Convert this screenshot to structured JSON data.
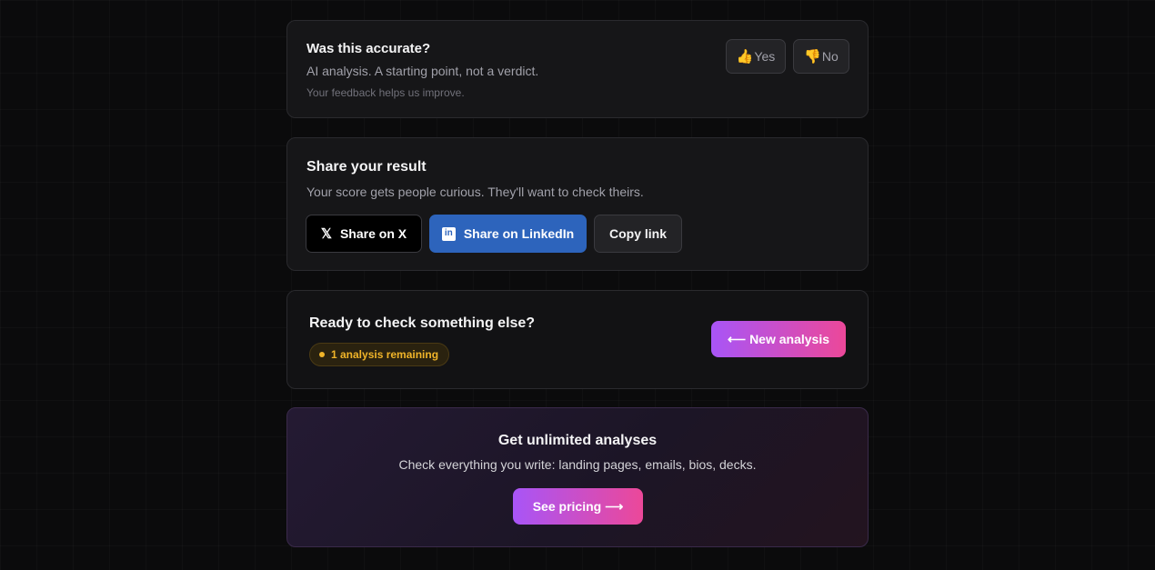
{
  "feedback": {
    "title": "Was this accurate?",
    "subtitle": "AI analysis. A starting point, not a verdict.",
    "note": "Your feedback helps us improve.",
    "yes_icon": "👍",
    "yes_label": "Yes",
    "no_icon": "👎",
    "no_label": "No"
  },
  "share": {
    "title": "Share your result",
    "subtitle": "Your score gets people curious. They'll want to check theirs.",
    "x_icon": "𝕏",
    "x_label": "Share on X",
    "linkedin_icon": "in",
    "linkedin_label": "Share on LinkedIn",
    "copy_label": "Copy link"
  },
  "next": {
    "title": "Ready to check something else?",
    "remaining_label": "1 analysis remaining",
    "new_analysis_arrow": "⟵",
    "new_analysis_label": "New analysis"
  },
  "upsell": {
    "title": "Get unlimited analyses",
    "subtitle": "Check everything you write: landing pages, emails, bios, decks.",
    "pricing_label": "See pricing",
    "pricing_arrow": "⟶"
  },
  "colors": {
    "background": "#0b0b0c",
    "card": "#161618",
    "linkedin": "#2d64bc",
    "gradient_start": "#a855f7",
    "gradient_end": "#ec4899",
    "badge_text": "#f0b429"
  }
}
